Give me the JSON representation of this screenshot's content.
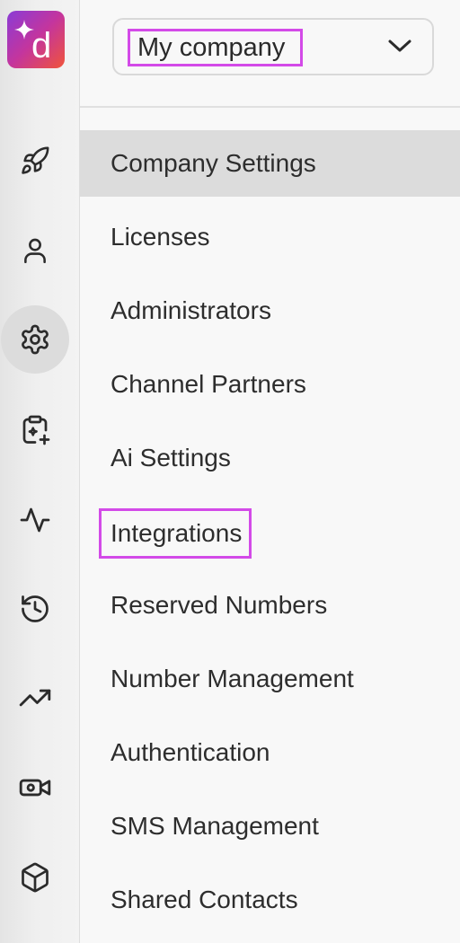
{
  "app": {
    "logo_letter": "d"
  },
  "rail": {
    "items": [
      {
        "icon": "rocket-icon"
      },
      {
        "icon": "user-icon"
      },
      {
        "icon": "gear-icon",
        "active": true
      },
      {
        "icon": "clipboard-sparkle-icon"
      },
      {
        "icon": "activity-icon"
      },
      {
        "icon": "history-icon"
      },
      {
        "icon": "trending-up-icon"
      },
      {
        "icon": "video-settings-icon"
      },
      {
        "icon": "cube-icon"
      }
    ]
  },
  "company_selector": {
    "name": "My company",
    "icon": "chevron-down-icon"
  },
  "menu": {
    "items": [
      {
        "label": "Company Settings",
        "active": true
      },
      {
        "label": "Licenses"
      },
      {
        "label": "Administrators"
      },
      {
        "label": "Channel Partners"
      },
      {
        "label": "Ai Settings"
      },
      {
        "label": "Integrations",
        "highlighted": true
      },
      {
        "label": "Reserved Numbers"
      },
      {
        "label": "Number Management"
      },
      {
        "label": "Authentication"
      },
      {
        "label": "SMS Management"
      },
      {
        "label": "Shared Contacts"
      }
    ]
  },
  "colors": {
    "highlight_border": "#d34ae8",
    "active_bg": "#dcdcdc",
    "logo_gradient": [
      "#8a3bd6",
      "#c4359d",
      "#f0543a"
    ]
  }
}
